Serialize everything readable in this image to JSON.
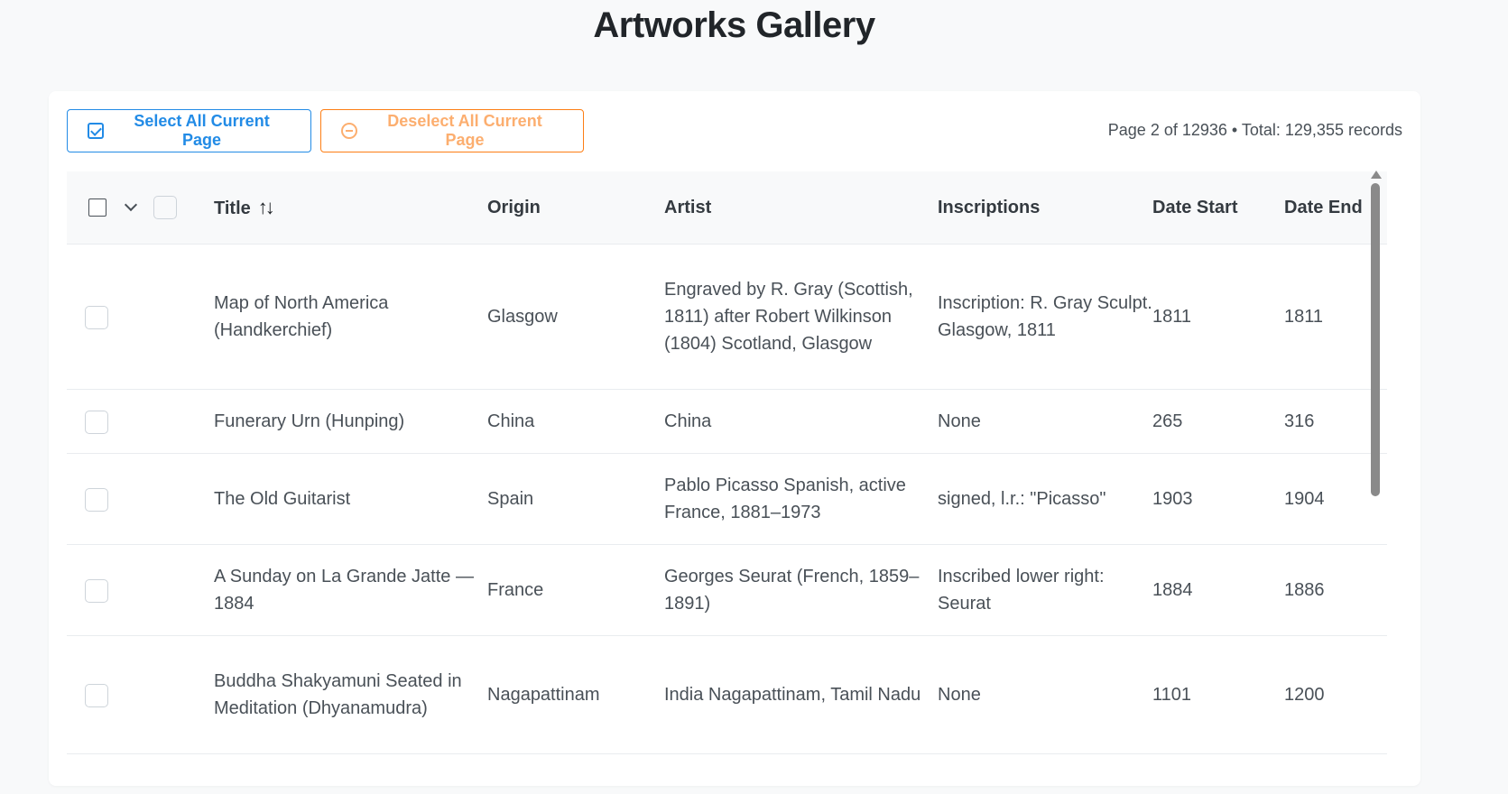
{
  "page": {
    "title": "Artworks Gallery"
  },
  "toolbar": {
    "select_all_label": "Select All Current Page",
    "deselect_all_label": "Deselect All Current Page",
    "page_info": "Page 2 of 12936 • Total: 129,355 records"
  },
  "table": {
    "columns": {
      "title": "Title",
      "origin": "Origin",
      "artist": "Artist",
      "inscriptions": "Inscriptions",
      "date_start": "Date Start",
      "date_end": "Date End"
    },
    "rows": [
      {
        "title": "Map of North America (Handkerchief)",
        "origin": "Glasgow",
        "artist": "Engraved by R. Gray (Scottish, 1811) after Robert Wilkinson (1804) Scotland, Glasgow",
        "inscriptions": "Inscription: R. Gray Sculpt. Glasgow, 1811",
        "date_start": "1811",
        "date_end": "1811"
      },
      {
        "title": "Funerary Urn (Hunping)",
        "origin": "China",
        "artist": "China",
        "inscriptions": "None",
        "date_start": "265",
        "date_end": "316"
      },
      {
        "title": "The Old Guitarist",
        "origin": "Spain",
        "artist": "Pablo Picasso Spanish, active France, 1881–1973",
        "inscriptions": "signed, l.r.: \"Picasso\"",
        "date_start": "1903",
        "date_end": "1904"
      },
      {
        "title": "A Sunday on La Grande Jatte — 1884",
        "origin": "France",
        "artist": "Georges Seurat (French, 1859–1891)",
        "inscriptions": "Inscribed lower right: Seurat",
        "date_start": "1884",
        "date_end": "1886"
      },
      {
        "title": "Buddha Shakyamuni Seated in Meditation (Dhyanamudra)",
        "origin": "Nagapattinam",
        "artist": "India Nagapattinam, Tamil Nadu",
        "inscriptions": "None",
        "date_start": "1101",
        "date_end": "1200"
      }
    ]
  }
}
